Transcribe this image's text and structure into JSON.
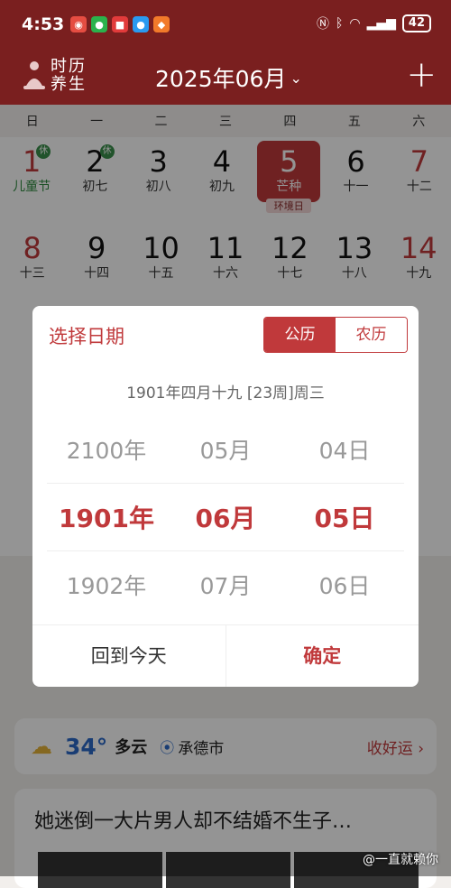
{
  "status_bar": {
    "time": "4:53",
    "battery": "42"
  },
  "header": {
    "logo_line1": "时历",
    "logo_line2": "养生",
    "month": "2025年06月"
  },
  "calendar": {
    "weekdays": [
      "日",
      "一",
      "二",
      "三",
      "四",
      "五",
      "六"
    ],
    "week1": [
      {
        "num": "1",
        "sub": "儿童节",
        "badge": "休"
      },
      {
        "num": "2",
        "sub": "初七",
        "badge": "休"
      },
      {
        "num": "3",
        "sub": "初八"
      },
      {
        "num": "4",
        "sub": "初九"
      },
      {
        "num": "5",
        "sub": "芒种",
        "tag": "环境日"
      },
      {
        "num": "6",
        "sub": "十一"
      },
      {
        "num": "7",
        "sub": "十二"
      }
    ],
    "week2": [
      {
        "num": "8",
        "sub": "十三"
      },
      {
        "num": "9",
        "sub": "十四"
      },
      {
        "num": "10",
        "sub": "十五"
      },
      {
        "num": "11",
        "sub": "十六"
      },
      {
        "num": "12",
        "sub": "十七"
      },
      {
        "num": "13",
        "sub": "十八"
      },
      {
        "num": "14",
        "sub": "十九"
      }
    ]
  },
  "dialog": {
    "title": "选择日期",
    "toggle_solar": "公历",
    "toggle_lunar": "农历",
    "summary": "1901年四月十九  [23周]周三",
    "years": [
      "2100年",
      "1901年",
      "1902年"
    ],
    "months": [
      "05月",
      "06月",
      "07月"
    ],
    "days": [
      "04日",
      "05日",
      "06日"
    ],
    "today_button": "回到今天",
    "confirm_button": "确定"
  },
  "weather": {
    "temp": "34°",
    "condition": "多云",
    "location": "承德市",
    "fortune": "收好运"
  },
  "news": {
    "title": "她迷倒一大片男人却不结婚不生子…"
  },
  "watermark": "@一直就赖你",
  "colors": {
    "brand_red": "#c0393b",
    "header_bg": "#7a1f1f"
  }
}
